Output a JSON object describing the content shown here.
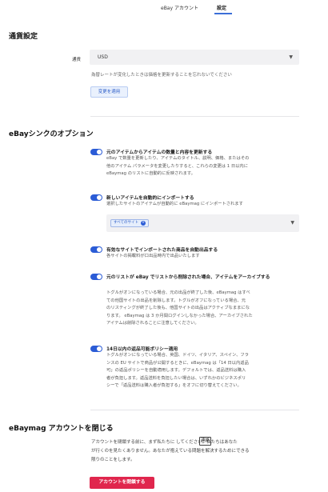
{
  "tabs": [
    {
      "label": "eBay アカウント",
      "active": false
    },
    {
      "label": "設定",
      "active": true
    }
  ],
  "currency_section": {
    "title": "通貨設定",
    "label": "通貨",
    "selected": "USD",
    "hint": "為替レートが変化したときは価格を更新することを忘れないでください",
    "apply_label": "変更を適用"
  },
  "sync_section": {
    "title": "eBayシンクのオプション",
    "options": [
      {
        "title": "元のアイテムからアイテムの数量と内容を更新する",
        "description": "eBay で数量を更新したり、アイテムのタイトル、説明、価格、またはその\n他のアイテム パラメータを変更したりすると、これらの変更は 1 日以内に\neBaymag のリストに自動的に反映されます。",
        "enabled": true
      },
      {
        "title": "新しいアイテムを自動的にインポートする",
        "description": "選択したサイトのアイテムが自動的に eBaymag にインポートされます",
        "enabled": true,
        "chip": "すべてのサイト"
      },
      {
        "title": "有効なサイトでインポートされた商品を自動出品する",
        "description": "各サイトの掲載料が口出品時内で出品いたします",
        "enabled": true
      },
      {
        "title": "元のリストが eBay でリストから削除された場合、アイテムをアーカイブする",
        "description": "トグルがオンになっている場合、元の出品が終了した後、eBaymag はすべ\nての他国サイトの出品を削除します。トグルがオフになっている場合、元\nのリスティングが終了した後も、他国サイトの出品はアクティブなままにな\nります。 eBaymag は 3 か月間ログインしなかった場合、アーカイブされた\nアイテムは削除されることに注意してください。",
        "enabled": true
      },
      {
        "title": "14日以内の返品可能ポリシー適用",
        "description": "トグルがオンになっている場合、英国、ドイツ、イタリア、スペイン、フラ\nンスの EU サイトで商品が公開するときに、eBaymag は「14 日以内返品\n可」の返品ポリシーを自動適用します。デフォルトでは、返品送料は購入\n者が負担します。返品送料を負担したい場合は、いずれかのビジネスポリ\nシーで「返品送料は購入者が負担する」をオフに切り替えてください。",
        "enabled": true
      }
    ]
  },
  "close_section": {
    "title": "eBaymag アカウントを閉じる",
    "description": "アカウントを閉鎖する前に、まず私たちに      してください。私たちはあなた\nが行くのを見たくありません。あなたが抱えている問題を解決するためにできる\n限りのことをします。",
    "contact_label": "連絡",
    "close_button": "アカウントを閉鎖する"
  },
  "colors": {
    "accent": "#2b5cd6",
    "danger": "#e0264d"
  }
}
